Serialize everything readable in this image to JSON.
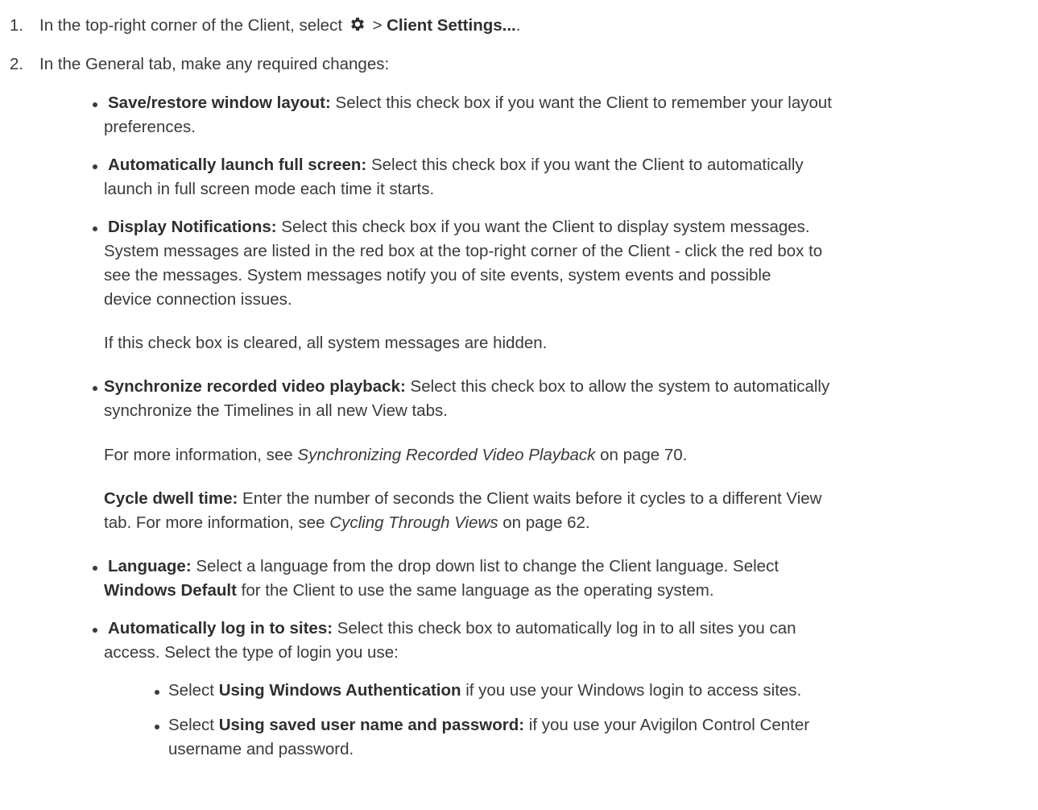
{
  "steps": [
    {
      "number": "1.",
      "prefix": "In the top-right corner of the Client, select",
      "icon": "gear-icon",
      "separator": ">",
      "bold": "Client Settings...",
      "suffix": "."
    },
    {
      "number": "2.",
      "text": "In the General tab, make any required changes:"
    }
  ],
  "options": {
    "save_restore": {
      "label": "Save/restore window layout:",
      "line1": "Select this check box if you want the Client to remember your layout",
      "line2": "preferences."
    },
    "full_screen": {
      "label": "Automatically launch full screen:",
      "line1": "Select this check box if you want the Client to automatically",
      "line2": "launch in full screen mode each time it starts."
    },
    "notifications": {
      "label": "Display Notifications:",
      "line1": "Select this check box if you want the Client to display system messages.",
      "line2": "System messages are listed in the red box at the top-right corner of the Client - click the red box to",
      "line3": "see the messages. System messages notify you of site events, system events and possible",
      "line4": "device connection issues.",
      "note": "If this check box is cleared, all system messages are hidden."
    },
    "synchronize": {
      "label": "Synchronize recorded video playback:",
      "line1": "Select this check box to allow the system to automatically",
      "line2": "synchronize the Timelines in all new View tabs.",
      "more_prefix": "For more information, see",
      "more_link": "Synchronizing Recorded Video Playback",
      "more_suffix": "on page 70."
    },
    "cycle_dwell": {
      "label": "Cycle dwell time:",
      "line1": "Enter the number of seconds the Client waits before it cycles to a different View",
      "line2_prefix": "tab. For more information, see",
      "line2_link": "Cycling Through Views",
      "line2_suffix": "on page 62."
    },
    "language": {
      "label": "Language:",
      "line1": "Select a language from the drop down list to change the Client language. Select",
      "line2_bold": "Windows Default",
      "line2_rest": "for the Client to use the same language as the operating system."
    },
    "auto_login": {
      "label": "Automatically log in to sites:",
      "line1": "Select this check box to automatically log in to all sites you can",
      "line2": "access. Select the type of login you use:",
      "sub": [
        {
          "prefix": "Select",
          "bold": "Using Windows Authentication",
          "rest": "if you use your Windows login to access sites."
        },
        {
          "prefix": "Select",
          "bold": "Using saved user name and password:",
          "rest": "if you use your Avigilon Control Center",
          "line2": "username and password."
        }
      ]
    }
  }
}
